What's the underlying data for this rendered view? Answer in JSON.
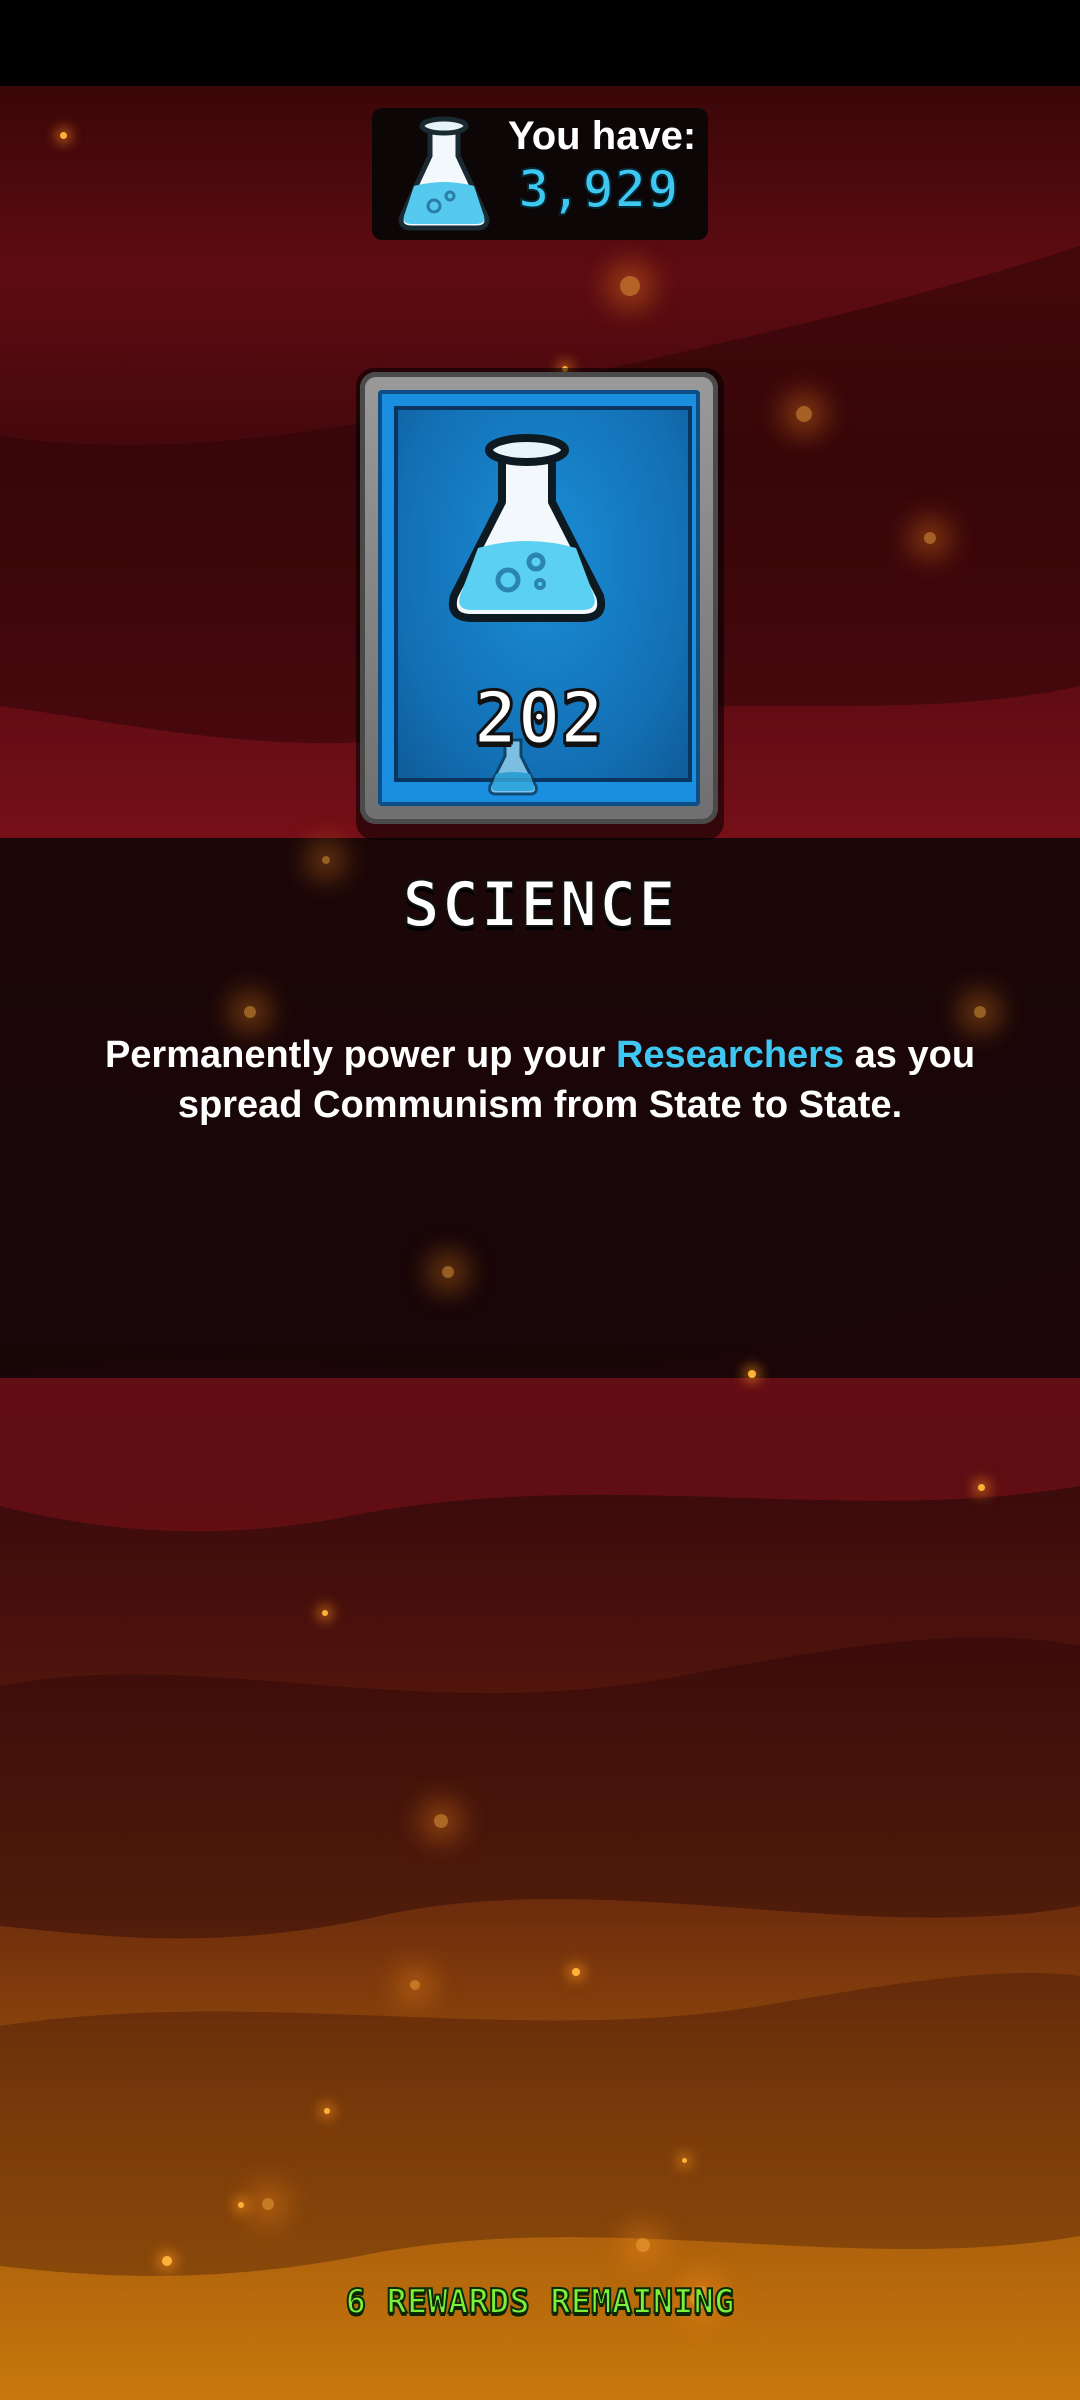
{
  "balance": {
    "label": "You have:",
    "value": "3,929",
    "icon": "science-flask-icon"
  },
  "reward_card": {
    "count": "202",
    "icon": "science-flask-icon"
  },
  "reward": {
    "title": "SCIENCE",
    "description_part1": "Permanently power up your ",
    "description_highlight": "Researchers",
    "description_part2": " as you spread Communism from State to State."
  },
  "footer": {
    "remaining": "6 REWARDS REMAINING"
  },
  "colors": {
    "accent_blue": "#3ec7f0",
    "remaining_green": "#7cf03a",
    "card_blue": "#1b8fdf"
  }
}
